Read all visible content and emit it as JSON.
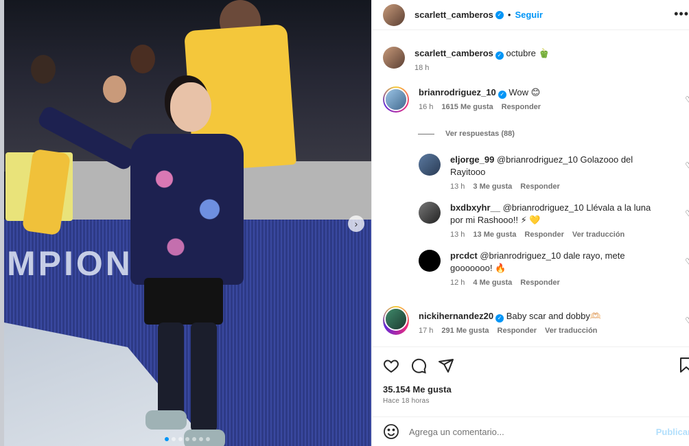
{
  "post": {
    "author": "scarlett_camberos",
    "follow_label": "Seguir",
    "caption": "octubre 🫑",
    "caption_time": "18 h",
    "more_icon": "more-horizontal-icon",
    "next_icon": "chevron-right-icon"
  },
  "photo": {
    "board_text": "MPION",
    "carousel_dots": 7,
    "active_dot": 0
  },
  "comments": [
    {
      "user": "brianrodriguez_10",
      "verified": true,
      "text": "Wow 😊",
      "time": "16 h",
      "likes": "1615 Me gusta",
      "reply": "Responder",
      "view_replies": "Ver respuestas (88)"
    },
    {
      "user": "eljorge_99",
      "text": "@brianrodriguez_10 Golazooo del Rayitooo",
      "time": "13 h",
      "likes": "3 Me gusta",
      "reply": "Responder"
    },
    {
      "user": "bxdbxyhr__",
      "text": "@brianrodriguez_10 Llévala a la luna por mi Rashooo!! ⚡ 💛",
      "time": "13 h",
      "likes": "13 Me gusta",
      "reply": "Responder",
      "translate": "Ver traducción"
    },
    {
      "user": "prcdct",
      "text": "@brianrodriguez_10 dale rayo, mete gooooooo! 🔥",
      "time": "12 h",
      "likes": "4 Me gusta",
      "reply": "Responder"
    },
    {
      "user": "nickihernandez20",
      "verified": true,
      "text": "Baby scar and dobby🫶🏻",
      "time": "17 h",
      "likes": "291 Me gusta",
      "reply": "Responder",
      "translate": "Ver traducción"
    }
  ],
  "actions": {
    "likes": "35.154 Me gusta",
    "posted_ago": "Hace 18 horas",
    "icons": [
      "heart-icon",
      "comment-icon",
      "share-icon",
      "bookmark-icon"
    ]
  },
  "add_comment": {
    "placeholder": "Agrega un comentario...",
    "post_label": "Publicar",
    "emoji_icon": "emoji-icon"
  },
  "colors": {
    "accent": "#0095f6",
    "muted": "#737373",
    "post_disabled": "#b2dffc"
  }
}
